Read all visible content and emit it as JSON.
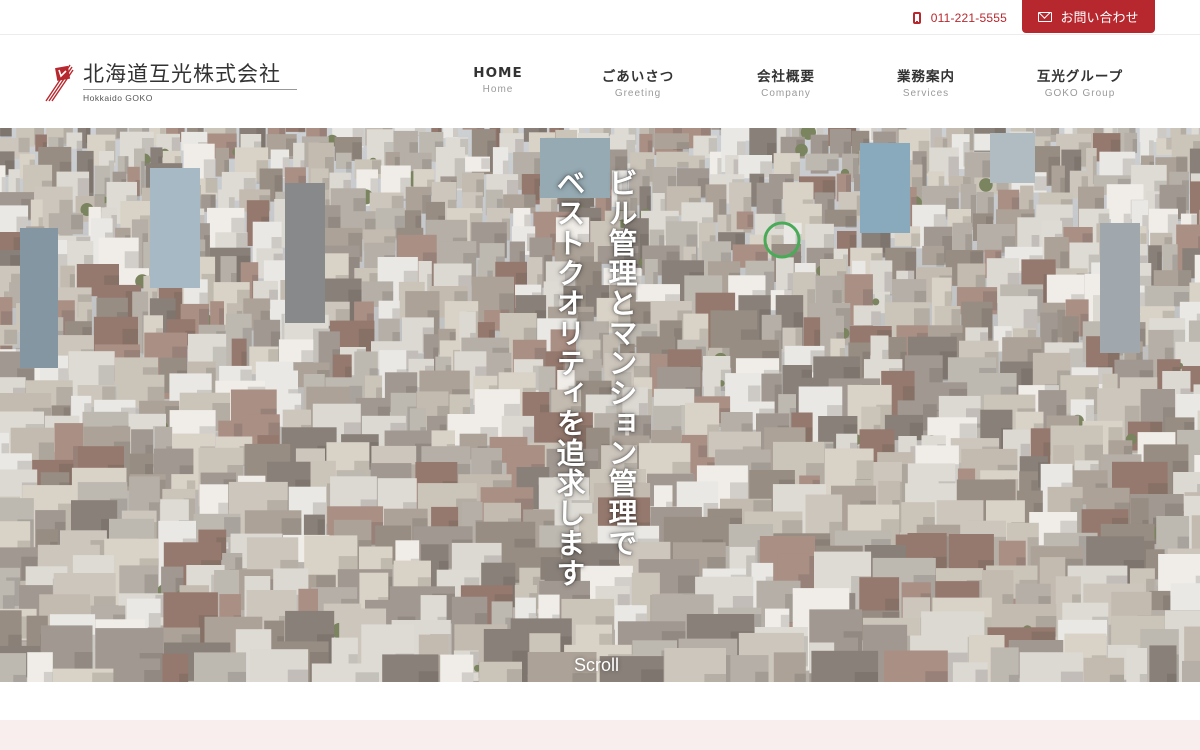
{
  "topbar": {
    "phone": "011-221-5555",
    "phone_icon": "mobile-phone-icon",
    "contact_label": "お問い合わせ",
    "contact_icon": "mail-icon"
  },
  "logo": {
    "name": "北海道互光株式会社",
    "sub": "Hokkaido GOKO"
  },
  "nav": [
    {
      "ja": "HOME",
      "en": "Home"
    },
    {
      "ja": "ごあいさつ",
      "en": "Greeting"
    },
    {
      "ja": "会社概要",
      "en": "Company"
    },
    {
      "ja": "業務案内",
      "en": "Services"
    },
    {
      "ja": "互光グループ",
      "en": "GOKO Group"
    }
  ],
  "hero": {
    "line1": "ビル管理とマンション管理で",
    "line2": "ベストクオリティを追求します",
    "scroll": "Scroll",
    "image_subject": "city-aerial-photo"
  },
  "colors": {
    "brand": "#b7282e",
    "band": "#f8eeee"
  }
}
